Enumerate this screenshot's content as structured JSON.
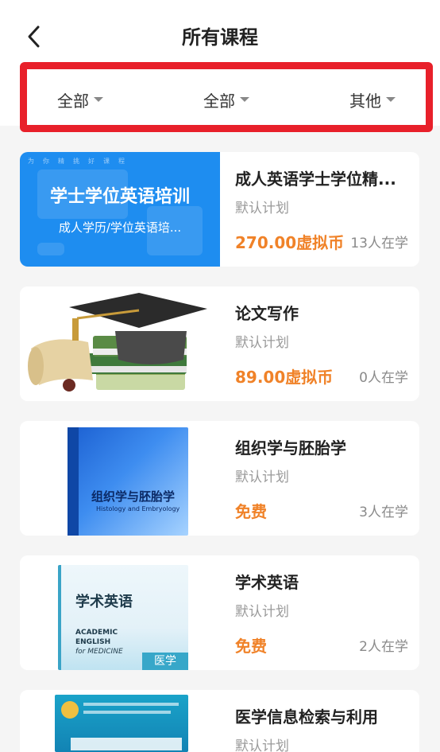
{
  "header": {
    "title": "所有课程"
  },
  "filters": [
    {
      "label": "全部"
    },
    {
      "label": "全部"
    },
    {
      "label": "其他"
    }
  ],
  "courses": [
    {
      "title": "成人英语学士学位精...",
      "plan": "默认计划",
      "price": "270.00虚拟币",
      "count": "13人在学",
      "thumb": {
        "top_text": "为你精挑好课程",
        "main": "学士学位英语培训",
        "sub": "成人学历/学位英语培..."
      }
    },
    {
      "title": "论文写作",
      "plan": "默认计划",
      "price": "89.00虚拟币",
      "count": "0人在学"
    },
    {
      "title": "组织学与胚胎学",
      "plan": "默认计划",
      "price": "免费",
      "count": "3人在学",
      "thumb": {
        "book_title": "组织学与胚胎学",
        "book_en": "Histology and Embryology"
      }
    },
    {
      "title": "学术英语",
      "plan": "默认计划",
      "price": "免费",
      "count": "2人在学",
      "thumb": {
        "book_title": "学术英语",
        "en1": "ACADEMIC",
        "en2": "ENGLISH",
        "en3": "for MEDICINE",
        "tag": "医学"
      }
    },
    {
      "title": "医学信息检索与利用",
      "plan": "默认计划",
      "price": "",
      "count": ""
    }
  ],
  "colors": {
    "accent_price": "#f08228",
    "highlight_border": "#e8202a",
    "banner_blue": "#1e8df0"
  }
}
